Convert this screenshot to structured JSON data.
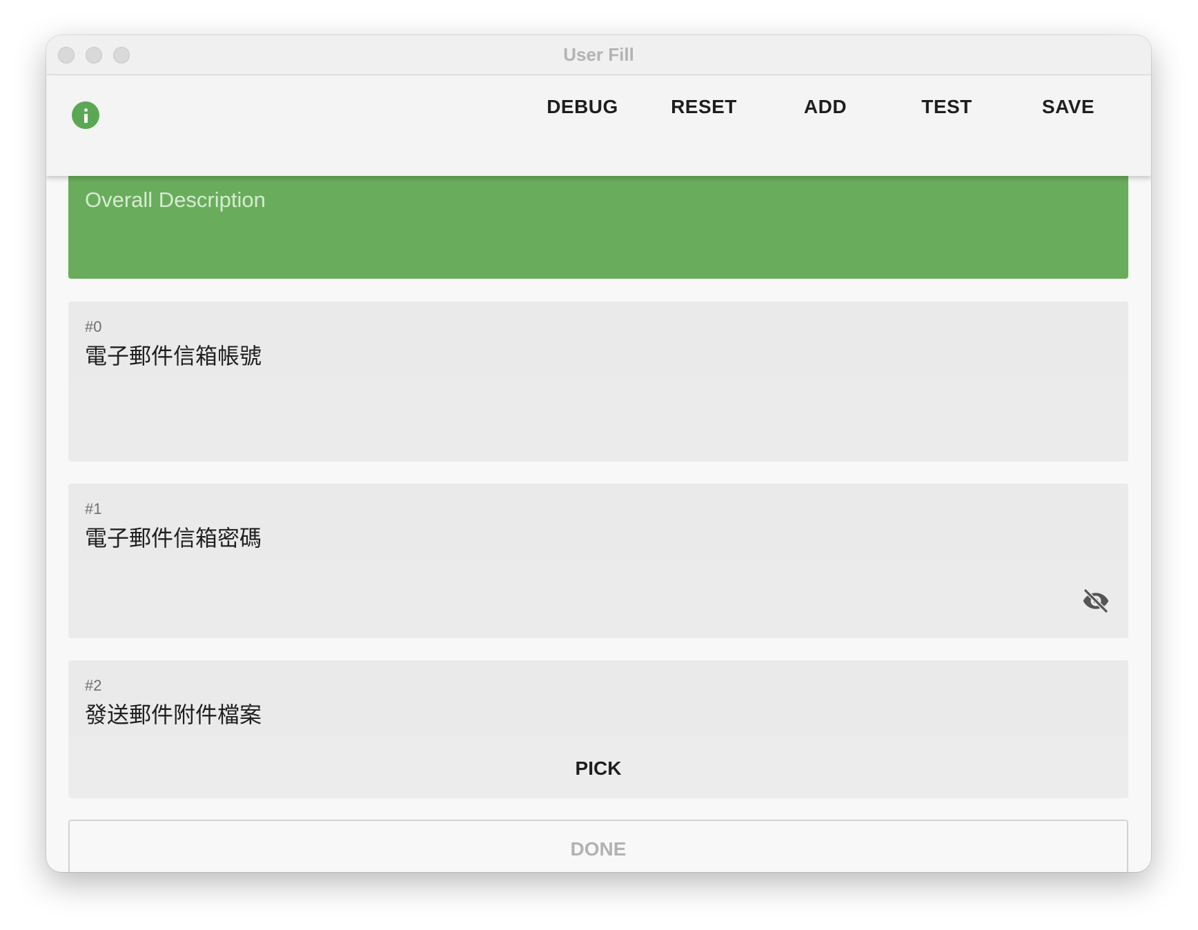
{
  "window": {
    "title": "User Fill"
  },
  "toolbar": {
    "info_icon": "info-circle-icon",
    "buttons": [
      "DEBUG",
      "RESET",
      "ADD",
      "TEST",
      "SAVE"
    ]
  },
  "description": {
    "placeholder": "Overall Description",
    "color": "#69ad5c"
  },
  "fields": [
    {
      "index": "#0",
      "label": "電子郵件信箱帳號",
      "value": ""
    },
    {
      "index": "#1",
      "label": "電子郵件信箱密碼",
      "value": "",
      "visibility_icon": "eye-off-icon"
    },
    {
      "index": "#2",
      "label": "發送郵件附件檔案",
      "action": "PICK"
    }
  ],
  "footer": {
    "done_label": "DONE"
  }
}
